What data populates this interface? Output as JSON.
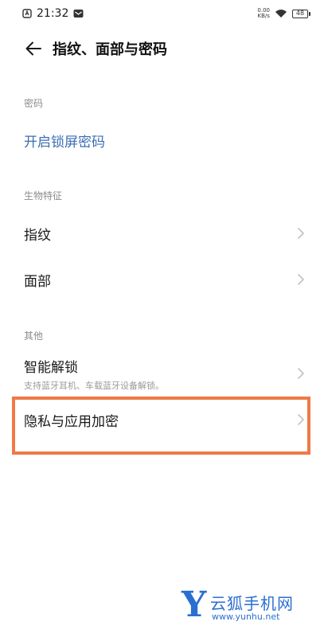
{
  "status_bar": {
    "time": "21:32",
    "net_speed_value": "0.00",
    "net_speed_unit": "KB/s",
    "battery": "48"
  },
  "header": {
    "title": "指纹、面部与密码"
  },
  "sections": {
    "password": {
      "label": "密码",
      "enable_lock_password": "开启锁屏密码"
    },
    "biometrics": {
      "label": "生物特征",
      "fingerprint": "指纹",
      "face": "面部"
    },
    "other": {
      "label": "其他",
      "smart_unlock": "智能解锁",
      "smart_unlock_desc": "支持蓝牙耳机、车载蓝牙设备解锁。",
      "privacy_encryption": "隐私与应用加密"
    }
  },
  "watermark": {
    "letter": "Y",
    "name": "云狐手机网",
    "url": "www.yunhu.net"
  },
  "colors": {
    "link": "#3b6db4",
    "highlight": "#ef7a46",
    "watermark": "#2a6fd0"
  }
}
